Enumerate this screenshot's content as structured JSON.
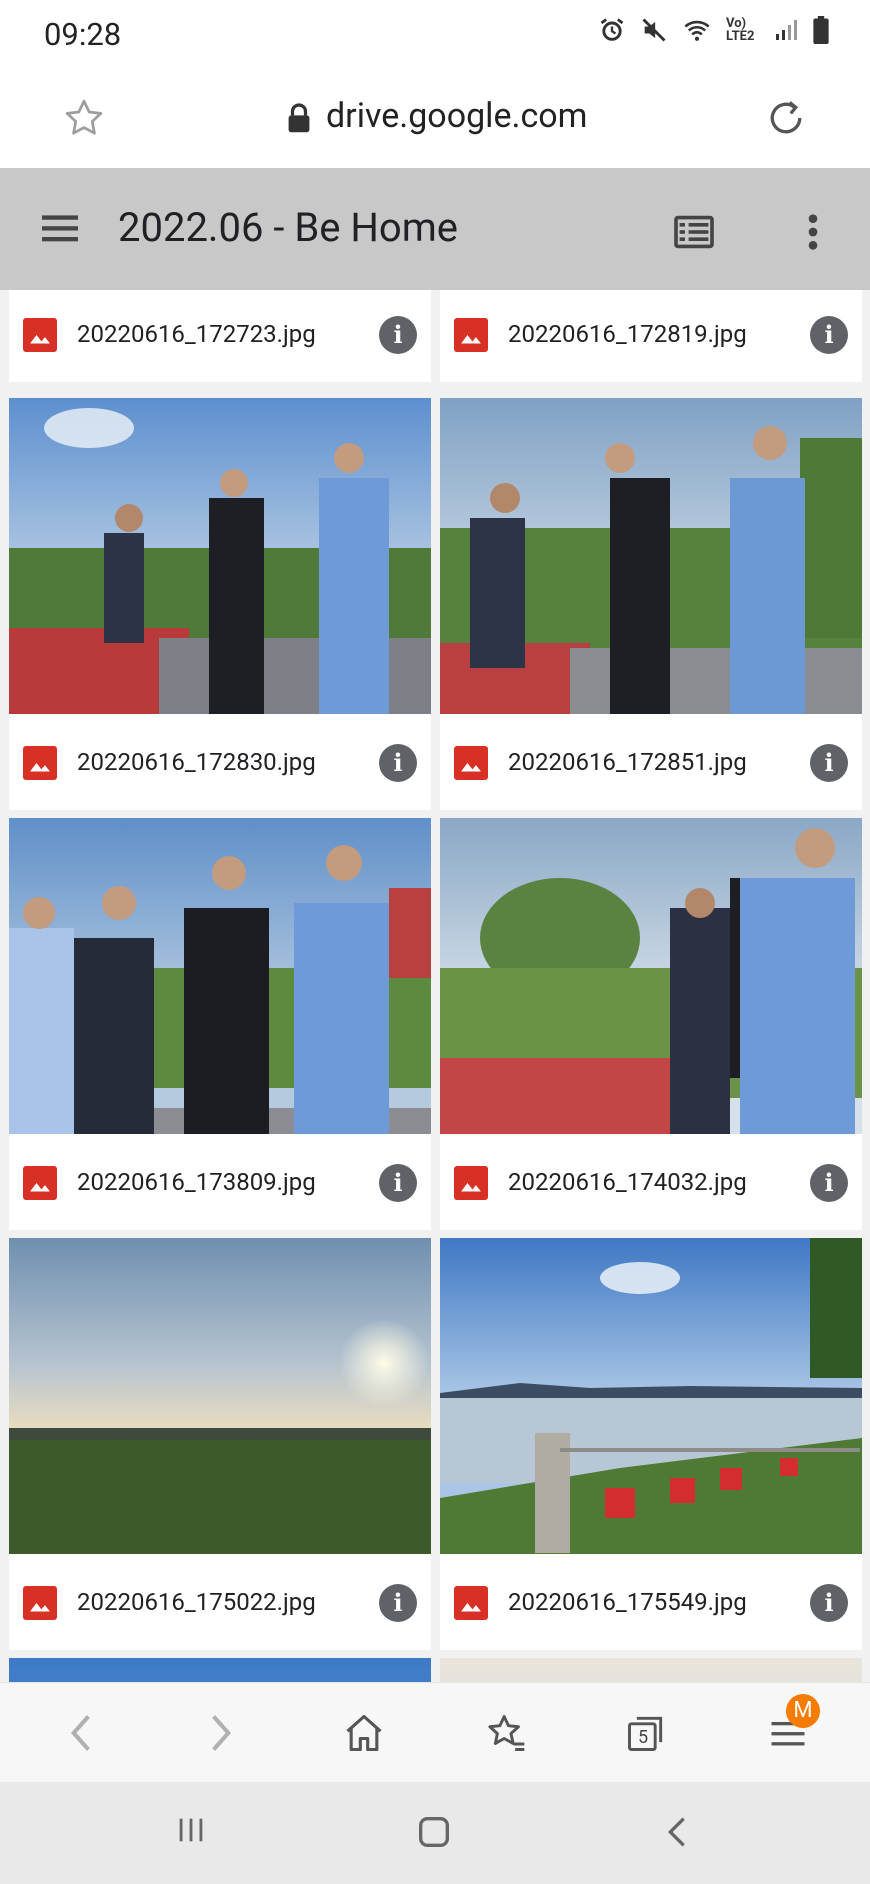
{
  "status_bar": {
    "time": "09:28",
    "network_label": "Vo) LTE2"
  },
  "browser": {
    "url": "drive.google.com",
    "tabs_count": "5",
    "profile_initial": "M"
  },
  "drive": {
    "folder_title": "2022.06 - Be Home"
  },
  "files": [
    {
      "name": "20220616_172723.jpg"
    },
    {
      "name": "20220616_172819.jpg"
    },
    {
      "name": "20220616_172830.jpg"
    },
    {
      "name": "20220616_172851.jpg"
    },
    {
      "name": "20220616_173809.jpg"
    },
    {
      "name": "20220616_174032.jpg"
    },
    {
      "name": "20220616_175022.jpg"
    },
    {
      "name": "20220616_175549.jpg"
    }
  ],
  "info_glyph": "i",
  "colors": {
    "appbar": "#c8c8c8",
    "file_type_icon": "#d93025",
    "badge": "#f57c00"
  }
}
